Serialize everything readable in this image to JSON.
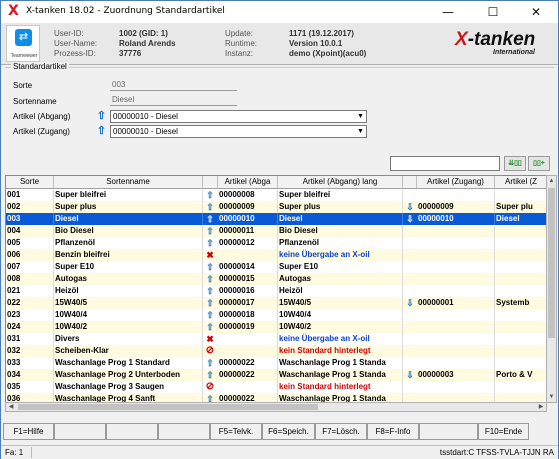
{
  "window": {
    "title": "X-tanken 18.02  - Zuordnung Standardartikel",
    "minimize": "—",
    "maximize": "☐",
    "close": "✕"
  },
  "info": {
    "teamviewer_label": "Teamviewer",
    "user_id_label": "User-ID:",
    "user_id": "1002 (GID: 1)",
    "user_name_label": "User-Name:",
    "user_name": "Roland Arends",
    "process_id_label": "Prozess-ID:",
    "process_id": "37776",
    "update_label": "Update:",
    "update": "1171 (19.12.2017)",
    "runtime_label": "Runtime:",
    "runtime": "Version 10.0.1",
    "instanz_label": "Instanz:",
    "instanz": "demo (Xpoint)(acu0)",
    "brand_x": "X",
    "brand_rest": "-tanken",
    "brand_sub": "International"
  },
  "form": {
    "group_title": "Standardartikel",
    "sorte_label": "Sorte",
    "sorte_value": "003",
    "sortenname_label": "Sortenname",
    "sortenname_value": "Diesel",
    "abgang_label": "Artikel (Abgang)",
    "abgang_value": "00000010 - Diesel",
    "zugang_label": "Artikel (Zugang)",
    "zugang_value": "00000010 - Diesel"
  },
  "search": {
    "btn1": "⇊▯▯",
    "btn2": "▯▯+"
  },
  "columns": [
    "Sorte",
    "Sortenname",
    "",
    "Artikel (Abga",
    "Artikel (Abgang) lang",
    "",
    "Artikel (Zugang)",
    "Artikel (Z"
  ],
  "rows": [
    {
      "sorte": "001",
      "name": "Super bleifrei",
      "ai": "up",
      "art": "00000008",
      "lang": "Super bleifrei",
      "lang_style": "b",
      "zi": "",
      "zart": "",
      "zlang": ""
    },
    {
      "sorte": "002",
      "name": "Super plus",
      "ai": "up",
      "art": "00000009",
      "lang": "Super plus",
      "lang_style": "b",
      "zi": "down",
      "zart": "00000009",
      "zlang": "Super plu"
    },
    {
      "sorte": "003",
      "name": "Diesel",
      "ai": "up",
      "art": "00000010",
      "lang": "Diesel",
      "lang_style": "b",
      "zi": "down",
      "zart": "00000010",
      "zlang": "Diesel"
    },
    {
      "sorte": "004",
      "name": "Bio Diesel",
      "ai": "up",
      "art": "00000011",
      "lang": "Bio Diesel",
      "lang_style": "b",
      "zi": "",
      "zart": "",
      "zlang": ""
    },
    {
      "sorte": "005",
      "name": "Pflanzenöl",
      "ai": "up",
      "art": "00000012",
      "lang": "Pflanzenöl",
      "lang_style": "b",
      "zi": "",
      "zart": "",
      "zlang": ""
    },
    {
      "sorte": "006",
      "name": "Benzin bleifrei",
      "ai": "x",
      "art": "",
      "lang": "keine Übergabe an X-oil",
      "lang_style": "blue",
      "zi": "",
      "zart": "",
      "zlang": ""
    },
    {
      "sorte": "007",
      "name": "Super E10",
      "ai": "up",
      "art": "00000014",
      "lang": "Super E10",
      "lang_style": "b",
      "zi": "",
      "zart": "",
      "zlang": ""
    },
    {
      "sorte": "008",
      "name": "Autogas",
      "ai": "up",
      "art": "00000015",
      "lang": "Autogas",
      "lang_style": "b",
      "zi": "",
      "zart": "",
      "zlang": ""
    },
    {
      "sorte": "021",
      "name": "Heizöl",
      "ai": "up",
      "art": "00000016",
      "lang": "Heizöl",
      "lang_style": "b",
      "zi": "",
      "zart": "",
      "zlang": ""
    },
    {
      "sorte": "022",
      "name": "15W40/5",
      "ai": "up",
      "art": "00000017",
      "lang": "15W40/5",
      "lang_style": "b",
      "zi": "down",
      "zart": "00000001",
      "zlang": "Systemb"
    },
    {
      "sorte": "023",
      "name": "10W40/4",
      "ai": "up",
      "art": "00000018",
      "lang": "10W40/4",
      "lang_style": "b",
      "zi": "",
      "zart": "",
      "zlang": ""
    },
    {
      "sorte": "024",
      "name": "10W40/2",
      "ai": "up",
      "art": "00000019",
      "lang": "10W40/2",
      "lang_style": "b",
      "zi": "",
      "zart": "",
      "zlang": ""
    },
    {
      "sorte": "031",
      "name": "Divers",
      "ai": "x",
      "art": "",
      "lang": "keine Übergabe an X-oil",
      "lang_style": "blue",
      "zi": "",
      "zart": "",
      "zlang": ""
    },
    {
      "sorte": "032",
      "name": "Scheiben-Klar",
      "ai": "no",
      "art": "",
      "lang": "kein Standard hinterlegt",
      "lang_style": "red",
      "zi": "",
      "zart": "",
      "zlang": ""
    },
    {
      "sorte": "033",
      "name": "Waschanlage Prog 1 Standard",
      "ai": "up",
      "art": "00000022",
      "lang": "Waschanlage Prog 1 Standa",
      "lang_style": "b",
      "zi": "",
      "zart": "",
      "zlang": ""
    },
    {
      "sorte": "034",
      "name": "Waschanlage Prog 2 Unterboden",
      "ai": "up",
      "art": "00000022",
      "lang": "Waschanlage Prog 1 Standa",
      "lang_style": "b",
      "zi": "down",
      "zart": "00000003",
      "zlang": "Porto & V"
    },
    {
      "sorte": "035",
      "name": "Waschanlage Prog 3 Saugen",
      "ai": "no",
      "art": "",
      "lang": "kein Standard hinterlegt",
      "lang_style": "red",
      "zi": "",
      "zart": "",
      "zlang": ""
    },
    {
      "sorte": "036",
      "name": "Waschanlage Prog 4 Sanft",
      "ai": "up",
      "art": "00000022",
      "lang": "Waschanlage Prog 1 Standa",
      "lang_style": "b",
      "zi": "",
      "zart": "",
      "zlang": ""
    }
  ],
  "selected_index": 2,
  "fkeys": [
    "F1=Hilfe",
    "",
    "",
    "",
    "F5=Telvk.",
    "F6=Speich.",
    "F7=Lösch.",
    "F8=F-Info",
    "",
    "F10=Ende"
  ],
  "status": {
    "left": "Fa: 1",
    "right": "tsstdart:C TFSS-TVLA-TJJN RA"
  }
}
